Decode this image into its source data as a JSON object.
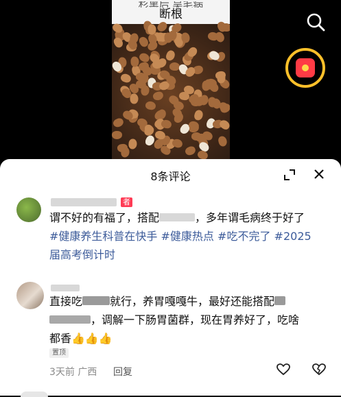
{
  "video": {
    "caption_cut": "杉黑后 吴毛病",
    "caption": "断根"
  },
  "comments_panel": {
    "title": "8条评论"
  },
  "comments": [
    {
      "author_tag": "者",
      "text_start": "谓不好的有福了，搭配",
      "text_mid": "，多年谓毛病终于好了",
      "hashtags": [
        "#健康养生科普在快手",
        "#健康热点",
        "#吃不完了",
        "#2025",
        "届高考倒计时"
      ]
    },
    {
      "line1_a": "直接吃",
      "line1_b": "就行，养胃嘎嘎牛，最好还能搭配",
      "line2": "，调解一下肠胃菌群，现在胃养好了，吃啥",
      "line3": "都香👍👍👍",
      "pin_label": "置顶",
      "meta": "3天前 广西",
      "reply_label": "回复"
    }
  ],
  "icons": {
    "search": "search-icon",
    "redpacket": "red-packet-icon",
    "expand": "expand-icon",
    "close": "close-icon",
    "like": "heart-icon",
    "dislike": "broken-heart-icon"
  }
}
